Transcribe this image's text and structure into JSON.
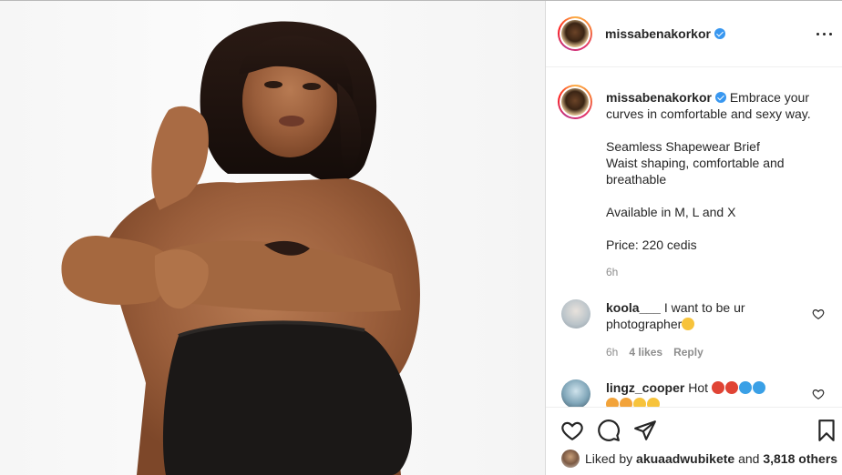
{
  "post": {
    "username": "missabenakorkor",
    "verified": true,
    "caption": "Embrace your curves in comfortable and sexy way.\n\nSeamless Shapewear Brief\nWaist shaping, comfortable and breathable\n\nAvailable in M, L and X\n\nPrice: 220 cedis",
    "caption_time": "6h",
    "photo_description_icon": "photo-icon"
  },
  "comments": [
    {
      "username": "koola___",
      "text": "I want to be ur photographer",
      "emoji": "😂",
      "time": "6h",
      "likes": "4 likes",
      "reply": "Reply"
    },
    {
      "username": "lingz_cooper",
      "text": "Hot",
      "emoji_line1": "😡😡💦💦",
      "emoji_line2": "😍😍😊😊"
    }
  ],
  "actions": {
    "like_icon": "heart-icon",
    "comment_icon": "comment-icon",
    "share_icon": "share-icon",
    "save_icon": "bookmark-icon"
  },
  "likes": {
    "prefix": "Liked by",
    "user": "akuaadwubikete",
    "connector": "and",
    "others": "3,818 others"
  },
  "colors": {
    "verified_blue": "#3897f0",
    "secondary_text": "#8e8e8e",
    "border": "#dbdbdb"
  }
}
